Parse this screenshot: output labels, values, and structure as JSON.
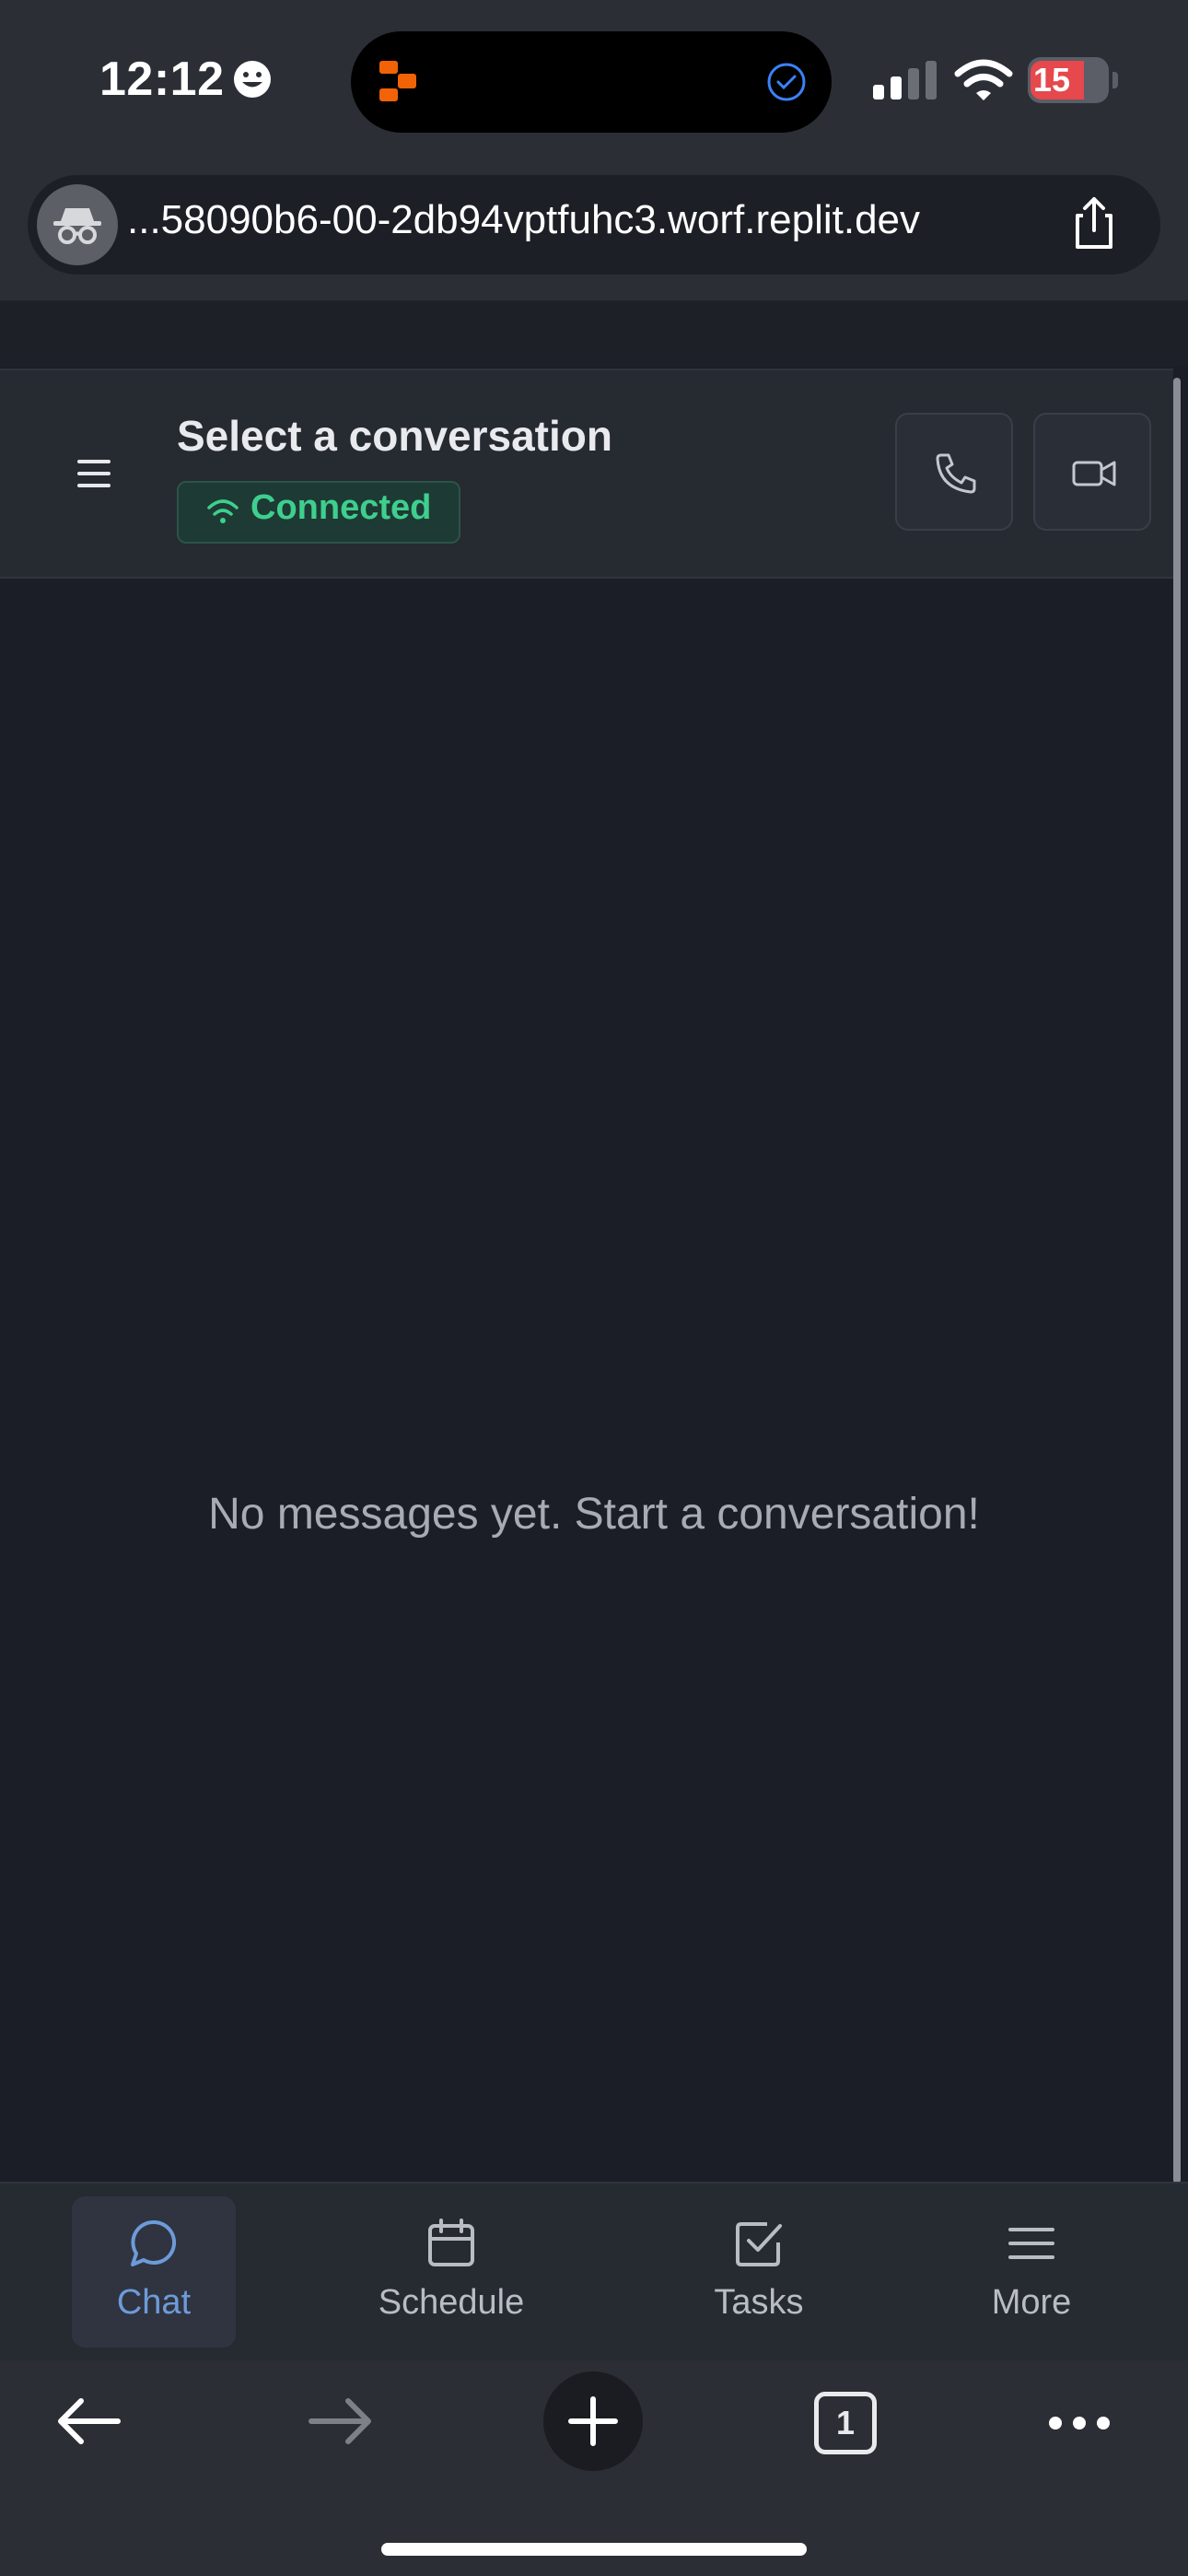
{
  "status_bar": {
    "time": "12:12",
    "battery": "15"
  },
  "browser": {
    "url": "...58090b6-00-2db94vptfuhc3.worf.replit.dev",
    "tab_count": "1"
  },
  "header": {
    "title": "Select a conversation",
    "connection_status": "Connected"
  },
  "main": {
    "empty_message": "No messages yet. Start a conversation!"
  },
  "tabs": [
    {
      "label": "Chat",
      "icon": "chat-bubble-icon",
      "active": true
    },
    {
      "label": "Schedule",
      "icon": "calendar-icon",
      "active": false
    },
    {
      "label": "Tasks",
      "icon": "checkbox-icon",
      "active": false
    },
    {
      "label": "More",
      "icon": "menu-icon",
      "active": false
    }
  ],
  "colors": {
    "background": "#1b1e26",
    "header": "#262a31",
    "connected_green": "#3ecf8e",
    "active_tab": "#6d9bd8"
  }
}
